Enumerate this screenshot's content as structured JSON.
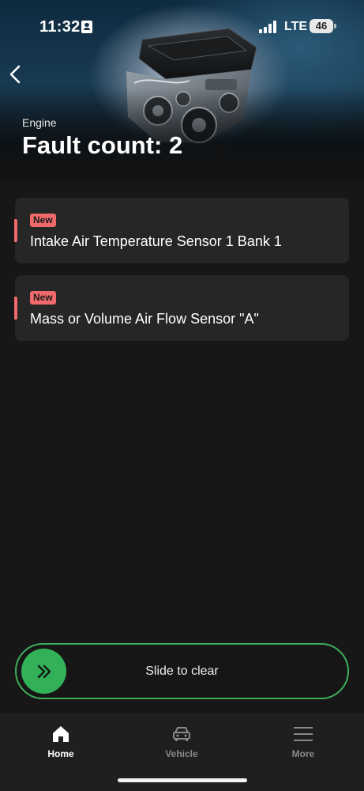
{
  "status_bar": {
    "time": "11:32",
    "network": "LTE",
    "battery": "46"
  },
  "header": {
    "back_icon": "chevron-left-icon",
    "label": "Engine",
    "title": "Fault count: 2",
    "image": "engine-photo"
  },
  "faults": [
    {
      "badge": "New",
      "title": "Intake Air Temperature Sensor 1 Bank 1",
      "status_color": "#f0696b"
    },
    {
      "badge": "New",
      "title": "Mass or Volume Air Flow Sensor \"A\"",
      "status_color": "#f0696b"
    }
  ],
  "slider": {
    "label": "Slide to clear",
    "icon": "double-chevron-right-icon",
    "accent": "#33b158"
  },
  "tabs": [
    {
      "label": "Home",
      "icon": "home-icon",
      "active": true
    },
    {
      "label": "Vehicle",
      "icon": "car-icon",
      "active": false
    },
    {
      "label": "More",
      "icon": "menu-icon",
      "active": false
    }
  ],
  "colors": {
    "background": "#171717",
    "card": "#262626",
    "alert": "#f0696b",
    "accent": "#33b158"
  }
}
